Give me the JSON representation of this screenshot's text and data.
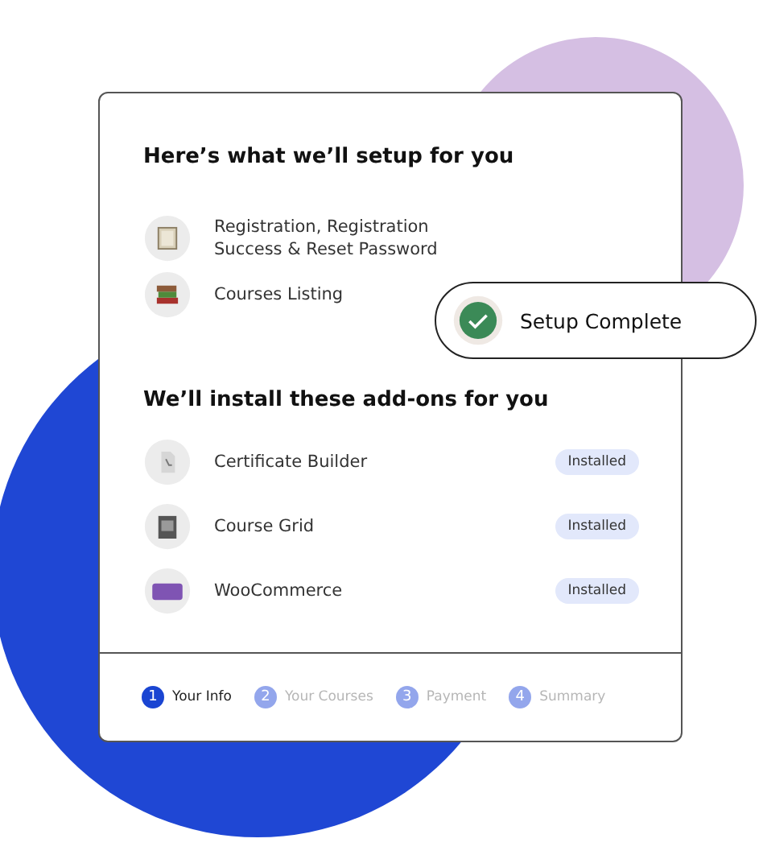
{
  "setup": {
    "title": "Here’s what we’ll setup for you",
    "items": [
      {
        "label": "Registration, Registration Success & Reset Password",
        "kind": "form"
      },
      {
        "label": "Courses Listing",
        "kind": "books"
      }
    ]
  },
  "toast": {
    "label": "Setup Complete"
  },
  "addons": {
    "title": "We’ll install these add-ons for you",
    "items": [
      {
        "label": "Certificate Builder",
        "kind": "certificate",
        "badge": "Installed"
      },
      {
        "label": "Course Grid",
        "kind": "grid",
        "badge": "Installed"
      },
      {
        "label": "WooCommerce",
        "kind": "woo",
        "badge": "Installed"
      }
    ]
  },
  "steps": [
    {
      "number": "1",
      "label": "Your Info",
      "selected": true
    },
    {
      "number": "2",
      "label": "Your Courses",
      "selected": false
    },
    {
      "number": "3",
      "label": "Payment",
      "selected": false
    },
    {
      "number": "4",
      "label": "Summary",
      "selected": false
    }
  ]
}
